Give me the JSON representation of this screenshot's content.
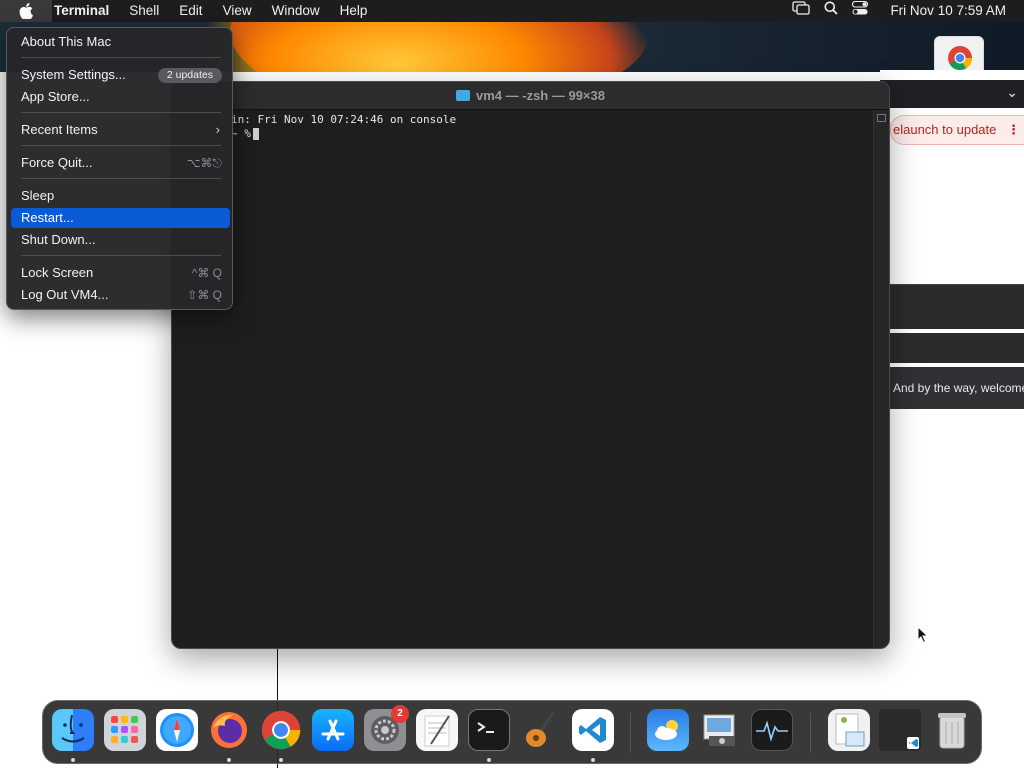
{
  "menubar": {
    "app_name": "Terminal",
    "menus": [
      "Shell",
      "Edit",
      "View",
      "Window",
      "Help"
    ],
    "clock": "Fri Nov 10  7:59 AM",
    "status_icons": [
      "screen-mirroring-icon",
      "spotlight-search-icon",
      "control-center-icon"
    ]
  },
  "apple_menu": {
    "items": [
      {
        "label": "About This Mac"
      },
      {
        "label": "System Settings...",
        "badge": "2 updates"
      },
      {
        "label": "App Store..."
      },
      {
        "label": "Recent Items",
        "submenu": true
      },
      {
        "label": "Force Quit...",
        "shortcut": "⌥⌘⎋"
      },
      {
        "label": "Sleep"
      },
      {
        "label": "Restart...",
        "selected": true
      },
      {
        "label": "Shut Down..."
      },
      {
        "label": "Lock Screen",
        "shortcut": "^⌘ Q"
      },
      {
        "label": "Log Out VM4...",
        "shortcut": "⇧⌘ Q"
      }
    ]
  },
  "terminal": {
    "title": "vm4 — -zsh — 99×38",
    "lines": [
      "in: Fri Nov 10 07:24:46 on console",
      "~ %"
    ]
  },
  "browser": {
    "relaunch_text": "elaunch to update",
    "welcome_text": "And by the way, welcome"
  },
  "dock": {
    "apps": [
      {
        "name": "Finder",
        "icon": "finder-icon",
        "running": true
      },
      {
        "name": "Launchpad",
        "icon": "launchpad-icon",
        "running": false
      },
      {
        "name": "Safari",
        "icon": "safari-icon",
        "running": false
      },
      {
        "name": "Firefox",
        "icon": "firefox-icon",
        "running": true
      },
      {
        "name": "Google Chrome",
        "icon": "chrome-icon",
        "running": true
      },
      {
        "name": "App Store",
        "icon": "app-store-icon",
        "running": false
      },
      {
        "name": "System Settings",
        "icon": "system-settings-icon",
        "running": false,
        "badge": "2"
      },
      {
        "name": "TextEdit",
        "icon": "textedit-icon",
        "running": false
      },
      {
        "name": "Terminal",
        "icon": "terminal-icon",
        "running": true
      },
      {
        "name": "Instruments",
        "icon": "instruments-icon",
        "running": false
      },
      {
        "name": "Visual Studio Code",
        "icon": "vscode-icon",
        "running": true
      },
      {
        "name": "Weather",
        "icon": "weather-icon",
        "running": false
      },
      {
        "name": "Preview",
        "icon": "preview-icon",
        "running": false
      },
      {
        "name": "Activity Monitor",
        "icon": "activity-monitor-icon",
        "running": false
      },
      {
        "name": "Downloads",
        "icon": "downloads-stack-icon",
        "running": false
      },
      {
        "name": "Code window",
        "icon": "minimized-window-icon",
        "running": false
      },
      {
        "name": "Trash",
        "icon": "trash-icon",
        "running": false
      }
    ]
  }
}
